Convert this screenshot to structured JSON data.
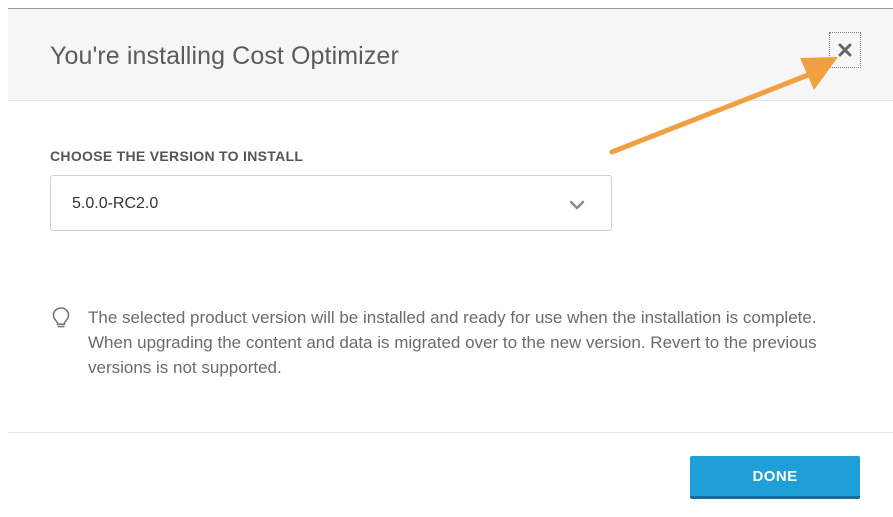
{
  "dialog": {
    "title": "You're installing Cost Optimizer",
    "close_icon": "close-icon"
  },
  "version": {
    "label": "CHOOSE THE VERSION TO INSTALL",
    "selected": "5.0.0-RC2.0",
    "chevron_icon": "chevron-down-icon"
  },
  "info": {
    "icon": "lightbulb-icon",
    "text": "The selected product version will be installed and ready for use when the installation is complete. When upgrading the content and data is migrated over to the new version. Revert to the previous versions is not supported."
  },
  "footer": {
    "done_label": "DONE"
  },
  "colors": {
    "primary_button": "#1e9fd8",
    "annotation_arrow": "#f0a040"
  }
}
